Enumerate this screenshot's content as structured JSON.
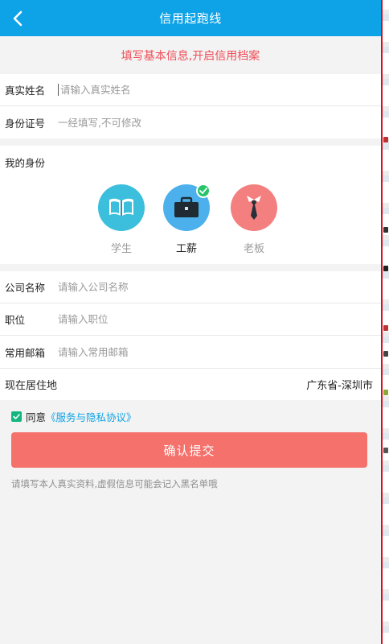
{
  "header": {
    "title": "信用起跑线",
    "back_icon": "chevron-left-icon"
  },
  "banner": {
    "text": "填写基本信息,开启信用档案",
    "color": "#ef4d57"
  },
  "basic": {
    "name": {
      "label": "真实姓名",
      "placeholder": "请输入真实姓名",
      "value": ""
    },
    "id_number": {
      "label": "身份证号",
      "placeholder": "一经填写,不可修改",
      "value": ""
    }
  },
  "identity": {
    "label": "我的身份",
    "options": [
      {
        "name": "学生",
        "icon": "book-icon",
        "color": "#3bbfdc",
        "selected": false
      },
      {
        "name": "工薪",
        "icon": "briefcase-icon",
        "color": "#4cb0ec",
        "selected": true
      },
      {
        "name": "老板",
        "icon": "tie-icon",
        "color": "#f47f7f",
        "selected": false
      }
    ]
  },
  "work": {
    "company": {
      "label": "公司名称",
      "placeholder": "请输入公司名称"
    },
    "position": {
      "label": "职位",
      "placeholder": "请输入职位"
    },
    "email": {
      "label": "常用邮箱",
      "placeholder": "请输入常用邮箱"
    }
  },
  "residence": {
    "label": "现在居住地",
    "value": "广东省-深圳市"
  },
  "agreement": {
    "checked": true,
    "prefix": "同意",
    "link": "《服务与隐私协议》"
  },
  "submit": {
    "label": "确认提交",
    "color": "#f4716c"
  },
  "note": "请填写本人真实资料,虚假信息可能会记入黑名单哦",
  "colors": {
    "primary": "#0ea2e6",
    "check": "#13b67d"
  }
}
